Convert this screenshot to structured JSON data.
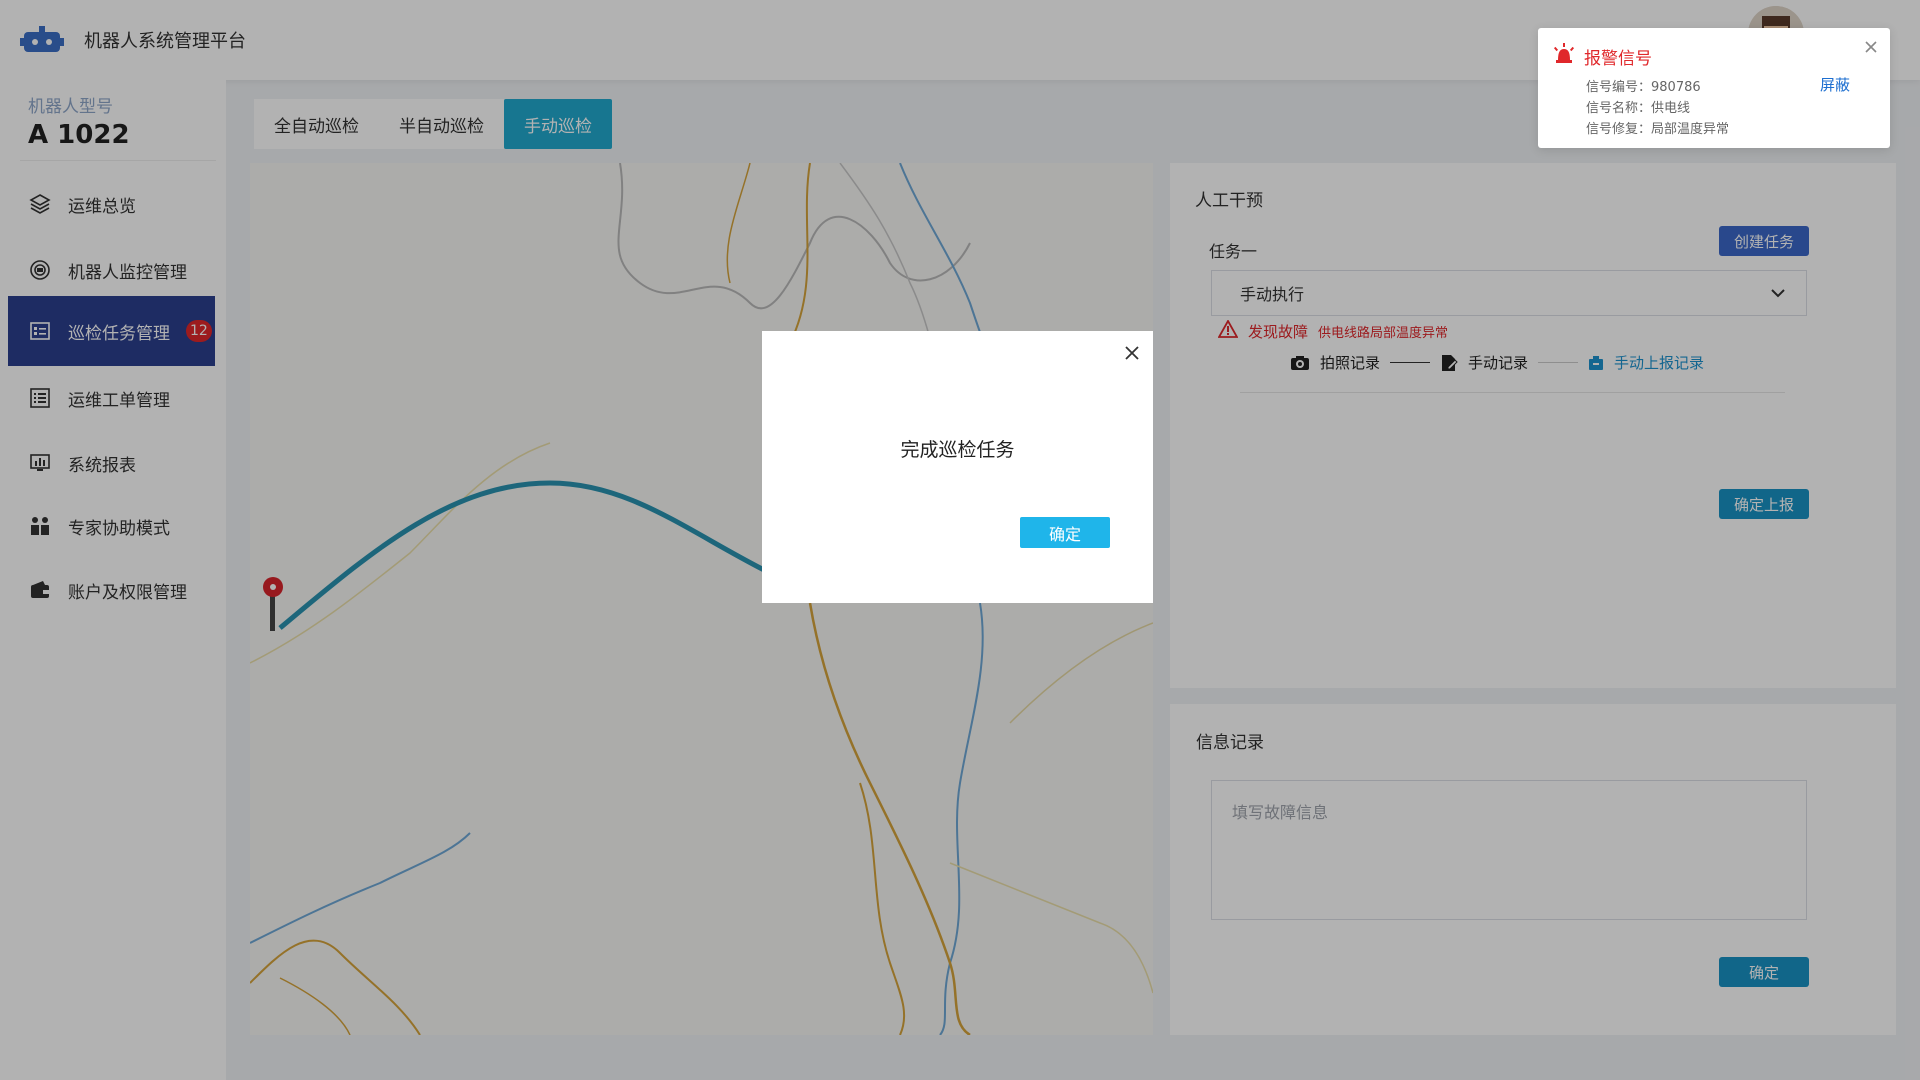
{
  "header": {
    "app_title": "机器人系统管理平台",
    "logo_icon": "robot-icon",
    "avatar_icon": "user-avatar"
  },
  "sidebar": {
    "model_label": "机器人型号",
    "model_value": "A 1022",
    "items": [
      {
        "label": "运维总览",
        "icon": "layers-icon"
      },
      {
        "label": "机器人监控管理",
        "icon": "monitor-circle-icon"
      },
      {
        "label": "巡检任务管理",
        "icon": "checklist-icon",
        "badge": "12",
        "active": true
      },
      {
        "label": "运维工单管理",
        "icon": "list-icon"
      },
      {
        "label": "系统报表",
        "icon": "report-icon"
      },
      {
        "label": "专家协助模式",
        "icon": "experts-icon"
      },
      {
        "label": "账户及权限管理",
        "icon": "wallet-icon"
      }
    ]
  },
  "tabs": [
    {
      "label": "全自动巡检"
    },
    {
      "label": "半自动巡检"
    },
    {
      "label": "手动巡检",
      "active": true
    }
  ],
  "intervention": {
    "title": "人工干预",
    "task_label": "任务一",
    "create_button": "创建任务",
    "select_value": "手动执行",
    "fault_title": "发现故障",
    "fault_desc": "供电线路局部温度异常",
    "steps": [
      {
        "label": "拍照记录",
        "icon": "camera-icon"
      },
      {
        "label": "手动记录",
        "icon": "edit-doc-icon"
      },
      {
        "label": "手动上报记录",
        "icon": "upload-icon",
        "active": true
      }
    ],
    "submit_button": "确定上报"
  },
  "info_record": {
    "title": "信息记录",
    "placeholder": "填写故障信息",
    "confirm_button": "确定"
  },
  "alert": {
    "title": "报警信号",
    "lines": [
      "信号编号：980786",
      "信号名称：供电线",
      "信号修复：局部温度异常"
    ],
    "shield_label": "屏蔽",
    "color": "#e0282b"
  },
  "modal": {
    "message": "完成巡检任务",
    "confirm_button": "确定"
  },
  "colors": {
    "primary": "#2b3f8f",
    "teal": "#21a9cf",
    "danger": "#e0282b"
  }
}
